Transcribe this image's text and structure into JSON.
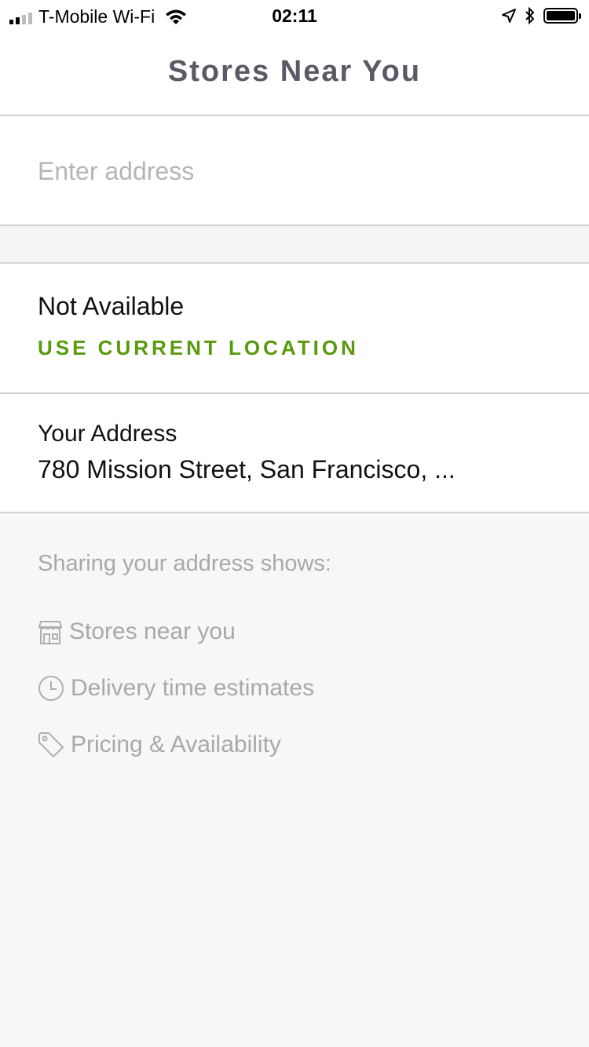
{
  "status_bar": {
    "carrier": "T-Mobile Wi-Fi",
    "time": "02:11",
    "icons": [
      "signal-icon",
      "wifi-icon",
      "location-arrow-icon",
      "bluetooth-icon",
      "battery-icon"
    ]
  },
  "header": {
    "title": "Stores Near You"
  },
  "search": {
    "placeholder": "Enter address",
    "value": ""
  },
  "location": {
    "status": "Not Available",
    "action_label": "USE CURRENT LOCATION",
    "action_color": "#5a9a0e"
  },
  "your_address": {
    "label": "Your Address",
    "value": "780 Mission Street, San Francisco, ..."
  },
  "info": {
    "heading": "Sharing your address shows:",
    "items": [
      {
        "icon": "store-icon",
        "label": "Stores near you"
      },
      {
        "icon": "clock-icon",
        "label": "Delivery time estimates"
      },
      {
        "icon": "tag-icon",
        "label": "Pricing & Availability"
      }
    ]
  },
  "colors": {
    "title_text": "#5a5a66",
    "muted_text": "#a9a9a9",
    "background": "#f7f7f7",
    "divider": "#d3d3d3"
  }
}
